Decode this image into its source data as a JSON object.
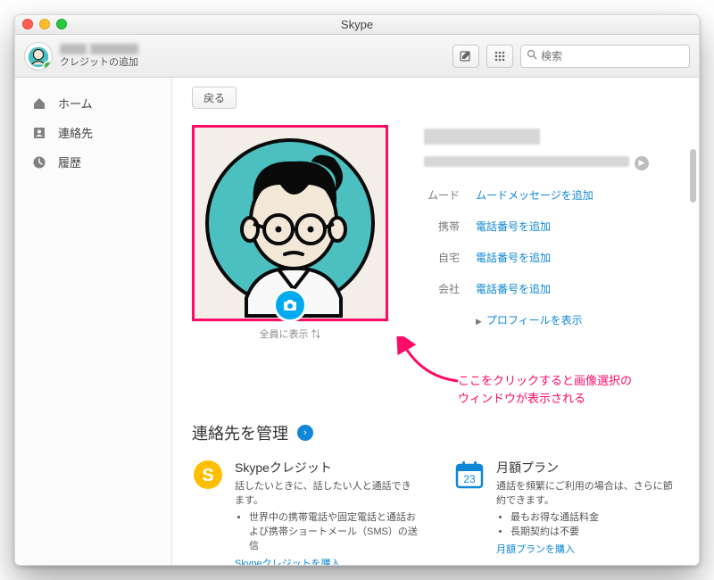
{
  "window": {
    "title": "Skype"
  },
  "toolbar": {
    "credit_label": "クレジットの追加",
    "compose_tooltip": "compose",
    "dialpad_tooltip": "dialpad",
    "search_placeholder": "検索"
  },
  "sidebar": {
    "items": [
      {
        "label": "ホーム",
        "icon": "home-icon"
      },
      {
        "label": "連絡先",
        "icon": "contacts-icon"
      },
      {
        "label": "履歴",
        "icon": "history-icon"
      }
    ]
  },
  "content": {
    "back_label": "戻る",
    "avatar_caption": "全員に表示 ⇅",
    "fields": {
      "mood": {
        "label": "ムード",
        "value": "ムードメッセージを追加"
      },
      "mobile": {
        "label": "携帯",
        "value": "電話番号を追加"
      },
      "home": {
        "label": "自宅",
        "value": "電話番号を追加"
      },
      "work": {
        "label": "会社",
        "value": "電話番号を追加"
      }
    },
    "show_profile": "プロフィールを表示"
  },
  "annotation": {
    "line1": "ここをクリックすると画像選択の",
    "line2": "ウィンドウが表示される"
  },
  "manage": {
    "heading": "連絡先を管理",
    "credit": {
      "title": "Skypeクレジット",
      "desc": "話したいときに、話したい人と通話できます。",
      "bullet1": "世界中の携帯電話や固定電話と通話および携帯ショートメール（SMS）の送信",
      "link": "Skypeクレジットを購入"
    },
    "plan": {
      "title": "月額プラン",
      "desc": "通話を頻繁にご利用の場合は、さらに節約できます。",
      "bullet1": "最もお得な通話料金",
      "bullet2": "長期契約は不要",
      "link": "月額プランを購入",
      "day": "23"
    }
  }
}
